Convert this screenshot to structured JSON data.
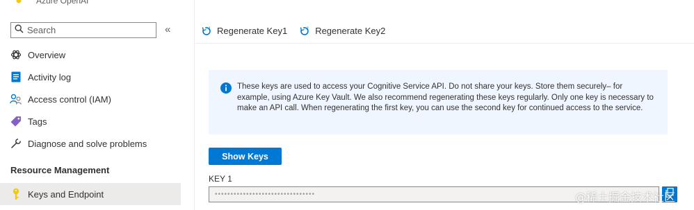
{
  "resource": {
    "type_label": "Azure OpenAI"
  },
  "search": {
    "placeholder": "Search"
  },
  "sidebar": {
    "items": [
      {
        "label": "Overview",
        "icon": "openai-icon"
      },
      {
        "label": "Activity log",
        "icon": "activity-log-icon"
      },
      {
        "label": "Access control (IAM)",
        "icon": "people-icon"
      },
      {
        "label": "Tags",
        "icon": "tag-icon"
      },
      {
        "label": "Diagnose and solve problems",
        "icon": "wrench-icon"
      }
    ],
    "section_header": "Resource Management",
    "section_items": [
      {
        "label": "Keys and Endpoint",
        "icon": "key-icon",
        "selected": true
      }
    ]
  },
  "toolbar": {
    "regenerate_key1": "Regenerate Key1",
    "regenerate_key2": "Regenerate Key2"
  },
  "info": {
    "text": "These keys are used to access your Cognitive Service API. Do not share your keys. Store them securely– for example, using Azure Key Vault. We also recommend regenerating these keys regularly. Only one key is necessary to make an API call. When regenerating the first key, you can use the second key for continued access to the service."
  },
  "keys": {
    "show_label": "Show Keys",
    "key1_label": "KEY 1",
    "key1_value": "••••••••••••••••••••••••••••••••"
  },
  "watermark": "@稀土掘金技术社区",
  "colors": {
    "accent": "#0078d4",
    "info_bg": "#f0f6ff",
    "key_gold": "#f2c811"
  }
}
